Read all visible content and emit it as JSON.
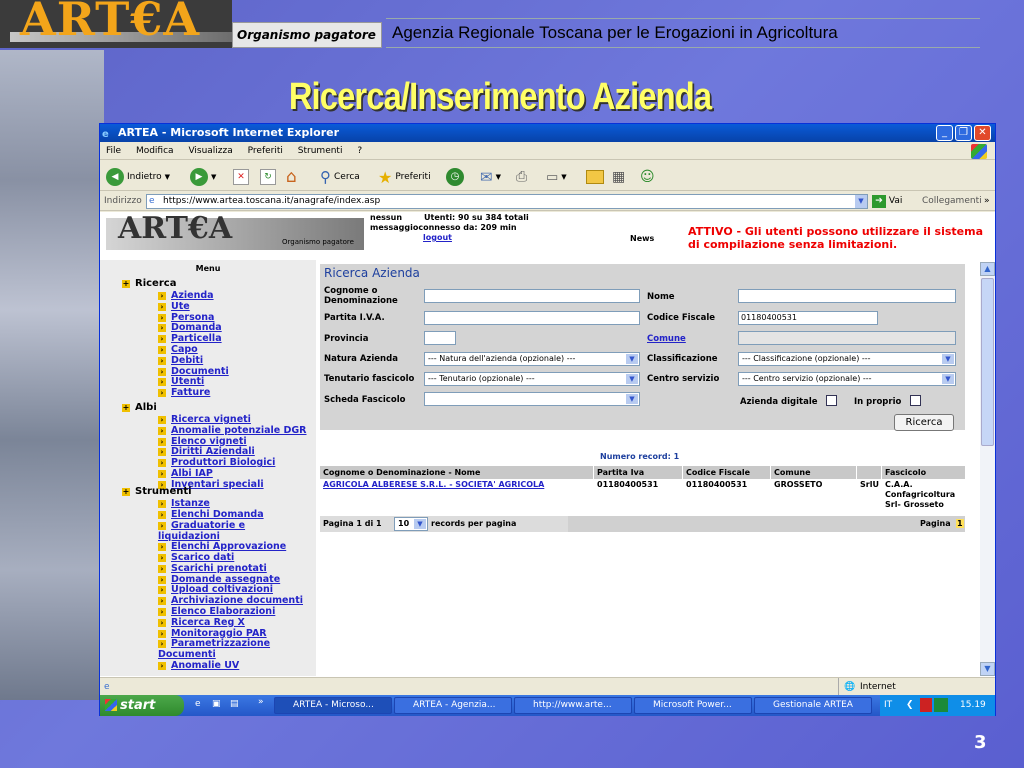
{
  "slide": {
    "logo": "ART€A",
    "organismo": "Organismo pagatore",
    "agency": "Agenzia Regionale Toscana per le Erogazioni in Agricoltura",
    "title": "Ricerca/Inserimento Azienda",
    "page_number": "3"
  },
  "window": {
    "title": "ARTEA - Microsoft Internet Explorer",
    "menu": [
      "File",
      "Modifica",
      "Visualizza",
      "Preferiti",
      "Strumenti",
      "?"
    ],
    "toolbar": {
      "back": "Indietro",
      "search": "Cerca",
      "favorites": "Preferiti"
    },
    "address_label": "Indirizzo",
    "url": "https://www.artea.toscana.it/anagrafe/index.asp",
    "go": "Vai",
    "links": "Collegamenti"
  },
  "page_header": {
    "logo": "ART€A",
    "logo_sub": "Organismo pagatore",
    "user_line1": "nessun",
    "user_line2": "messaggio",
    "users_online": "Utenti: 90 su 384 totali",
    "connected": "connesso da: 209 min",
    "logout": "logout",
    "news": "News",
    "alert": "ATTIVO - Gli utenti possono utilizzare il sistema di compilazione senza limitazioni."
  },
  "sidebar": {
    "title": "Menu",
    "ricerca": {
      "label": "Ricerca",
      "items": [
        "Azienda",
        "Ute",
        "Persona",
        "Domanda",
        "Particella",
        "Capo",
        "Debiti",
        "Documenti",
        "Utenti",
        "Fatture"
      ]
    },
    "albi": {
      "label": "Albi",
      "items": [
        "Ricerca vigneti",
        "Anomalie potenziale DGR",
        "Elenco vigneti",
        "Diritti Aziendali",
        "Produttori Biologici",
        "Albi IAP",
        "Inventari speciali"
      ]
    },
    "strumenti": {
      "label": "Strumenti",
      "items": [
        "Istanze",
        "Elenchi Domanda",
        "Graduatorie e liquidazioni",
        "Elenchi Approvazione",
        "Scarico dati",
        "Scarichi prenotati",
        "Domande assegnate",
        "Upload coltivazioni",
        "Archiviazione documenti",
        "Elenco Elaborazioni",
        "Ricerca Reg X",
        "Monitoraggio PAR",
        "Parametrizzazione Documenti",
        "Anomalie UV"
      ]
    }
  },
  "form": {
    "title": "Ricerca Azienda",
    "labels": {
      "cognome": "Cognome o Denominazione",
      "nome": "Nome",
      "piva": "Partita I.V.A.",
      "cf": "Codice Fiscale",
      "provincia": "Provincia",
      "comune": "Comune",
      "natura": "Natura Azienda",
      "classificazione": "Classificazione",
      "tenutario": "Tenutario fascicolo",
      "centro": "Centro servizio",
      "scheda": "Scheda Fascicolo",
      "digitale": "Azienda digitale",
      "proprio": "In proprio"
    },
    "values": {
      "cognome": "",
      "nome": "",
      "piva": "",
      "cf": "01180400531",
      "provincia": "",
      "comune": "",
      "natura": "--- Natura dell'azienda (opzionale) ---",
      "classificazione": "--- Classificazione (opzionale) ---",
      "tenutario": "--- Tenutario (opzionale) ---",
      "centro": "--- Centro servizio (opzionale) ---",
      "scheda": ""
    },
    "button": "Ricerca"
  },
  "results": {
    "count_text": "Numero record: 1",
    "columns": [
      "Cognome o Denominazione - Nome",
      "Partita Iva",
      "Codice Fiscale",
      "Comune",
      "",
      "Fascicolo"
    ],
    "rows": [
      {
        "name": "AGRICOLA ALBERESE S.R.L. - SOCIETA' AGRICOLA",
        "piva": "01180400531",
        "cf": "01180400531",
        "comune": "GROSSETO",
        "type": "SrlU",
        "fascicolo": "C.A.A. Confagricoltura Srl- Grosseto"
      }
    ],
    "pager_left": "Pagina 1 di 1",
    "per_page": "10",
    "per_page_label": "records per pagina",
    "pager_right": "Pagina",
    "current_page": "1"
  },
  "status": {
    "zone": "Internet"
  },
  "taskbar": {
    "start": "start",
    "tasks": [
      "ARTEA - Microso...",
      "ARTEA - Agenzia...",
      "http://www.arte...",
      "Microsoft Power...",
      "Gestionale ARTEA"
    ],
    "lang": "IT",
    "clock": "15.19"
  }
}
